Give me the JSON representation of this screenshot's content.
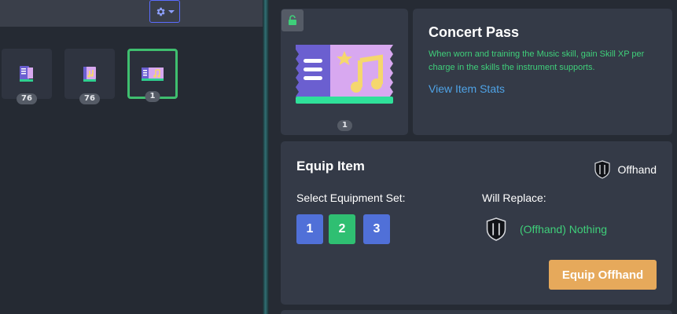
{
  "colors": {
    "accent_green": "#3fcf7a",
    "link_blue": "#4fa3e6",
    "equip_orange": "#e6a95b",
    "set1": "#5070d8",
    "set2": "#2fbf72",
    "set3": "#5070d8"
  },
  "toolbar": {
    "settings_icon": "gear-icon",
    "dropdown_icon": "chevron-down-icon"
  },
  "inventory": {
    "items": [
      {
        "icon": "music-sheet-icon",
        "quantity": "76"
      },
      {
        "icon": "music-scroll-icon",
        "quantity": "76"
      },
      {
        "icon": "concert-pass-icon",
        "quantity": "1"
      }
    ]
  },
  "item": {
    "name": "Concert Pass",
    "description": "When worn and training the Music skill, gain Skill XP per charge in the skills the instrument supports.",
    "view_stats": "View Item Stats",
    "quantity": "1",
    "lock_icon": "unlock-icon"
  },
  "equip": {
    "title": "Equip Item",
    "slot": "Offhand",
    "select_set_label": "Select Equipment Set:",
    "will_replace_label": "Will Replace:",
    "sets": [
      "1",
      "2",
      "3"
    ],
    "replace_text": "(Offhand) Nothing",
    "button": "Equip Offhand"
  }
}
